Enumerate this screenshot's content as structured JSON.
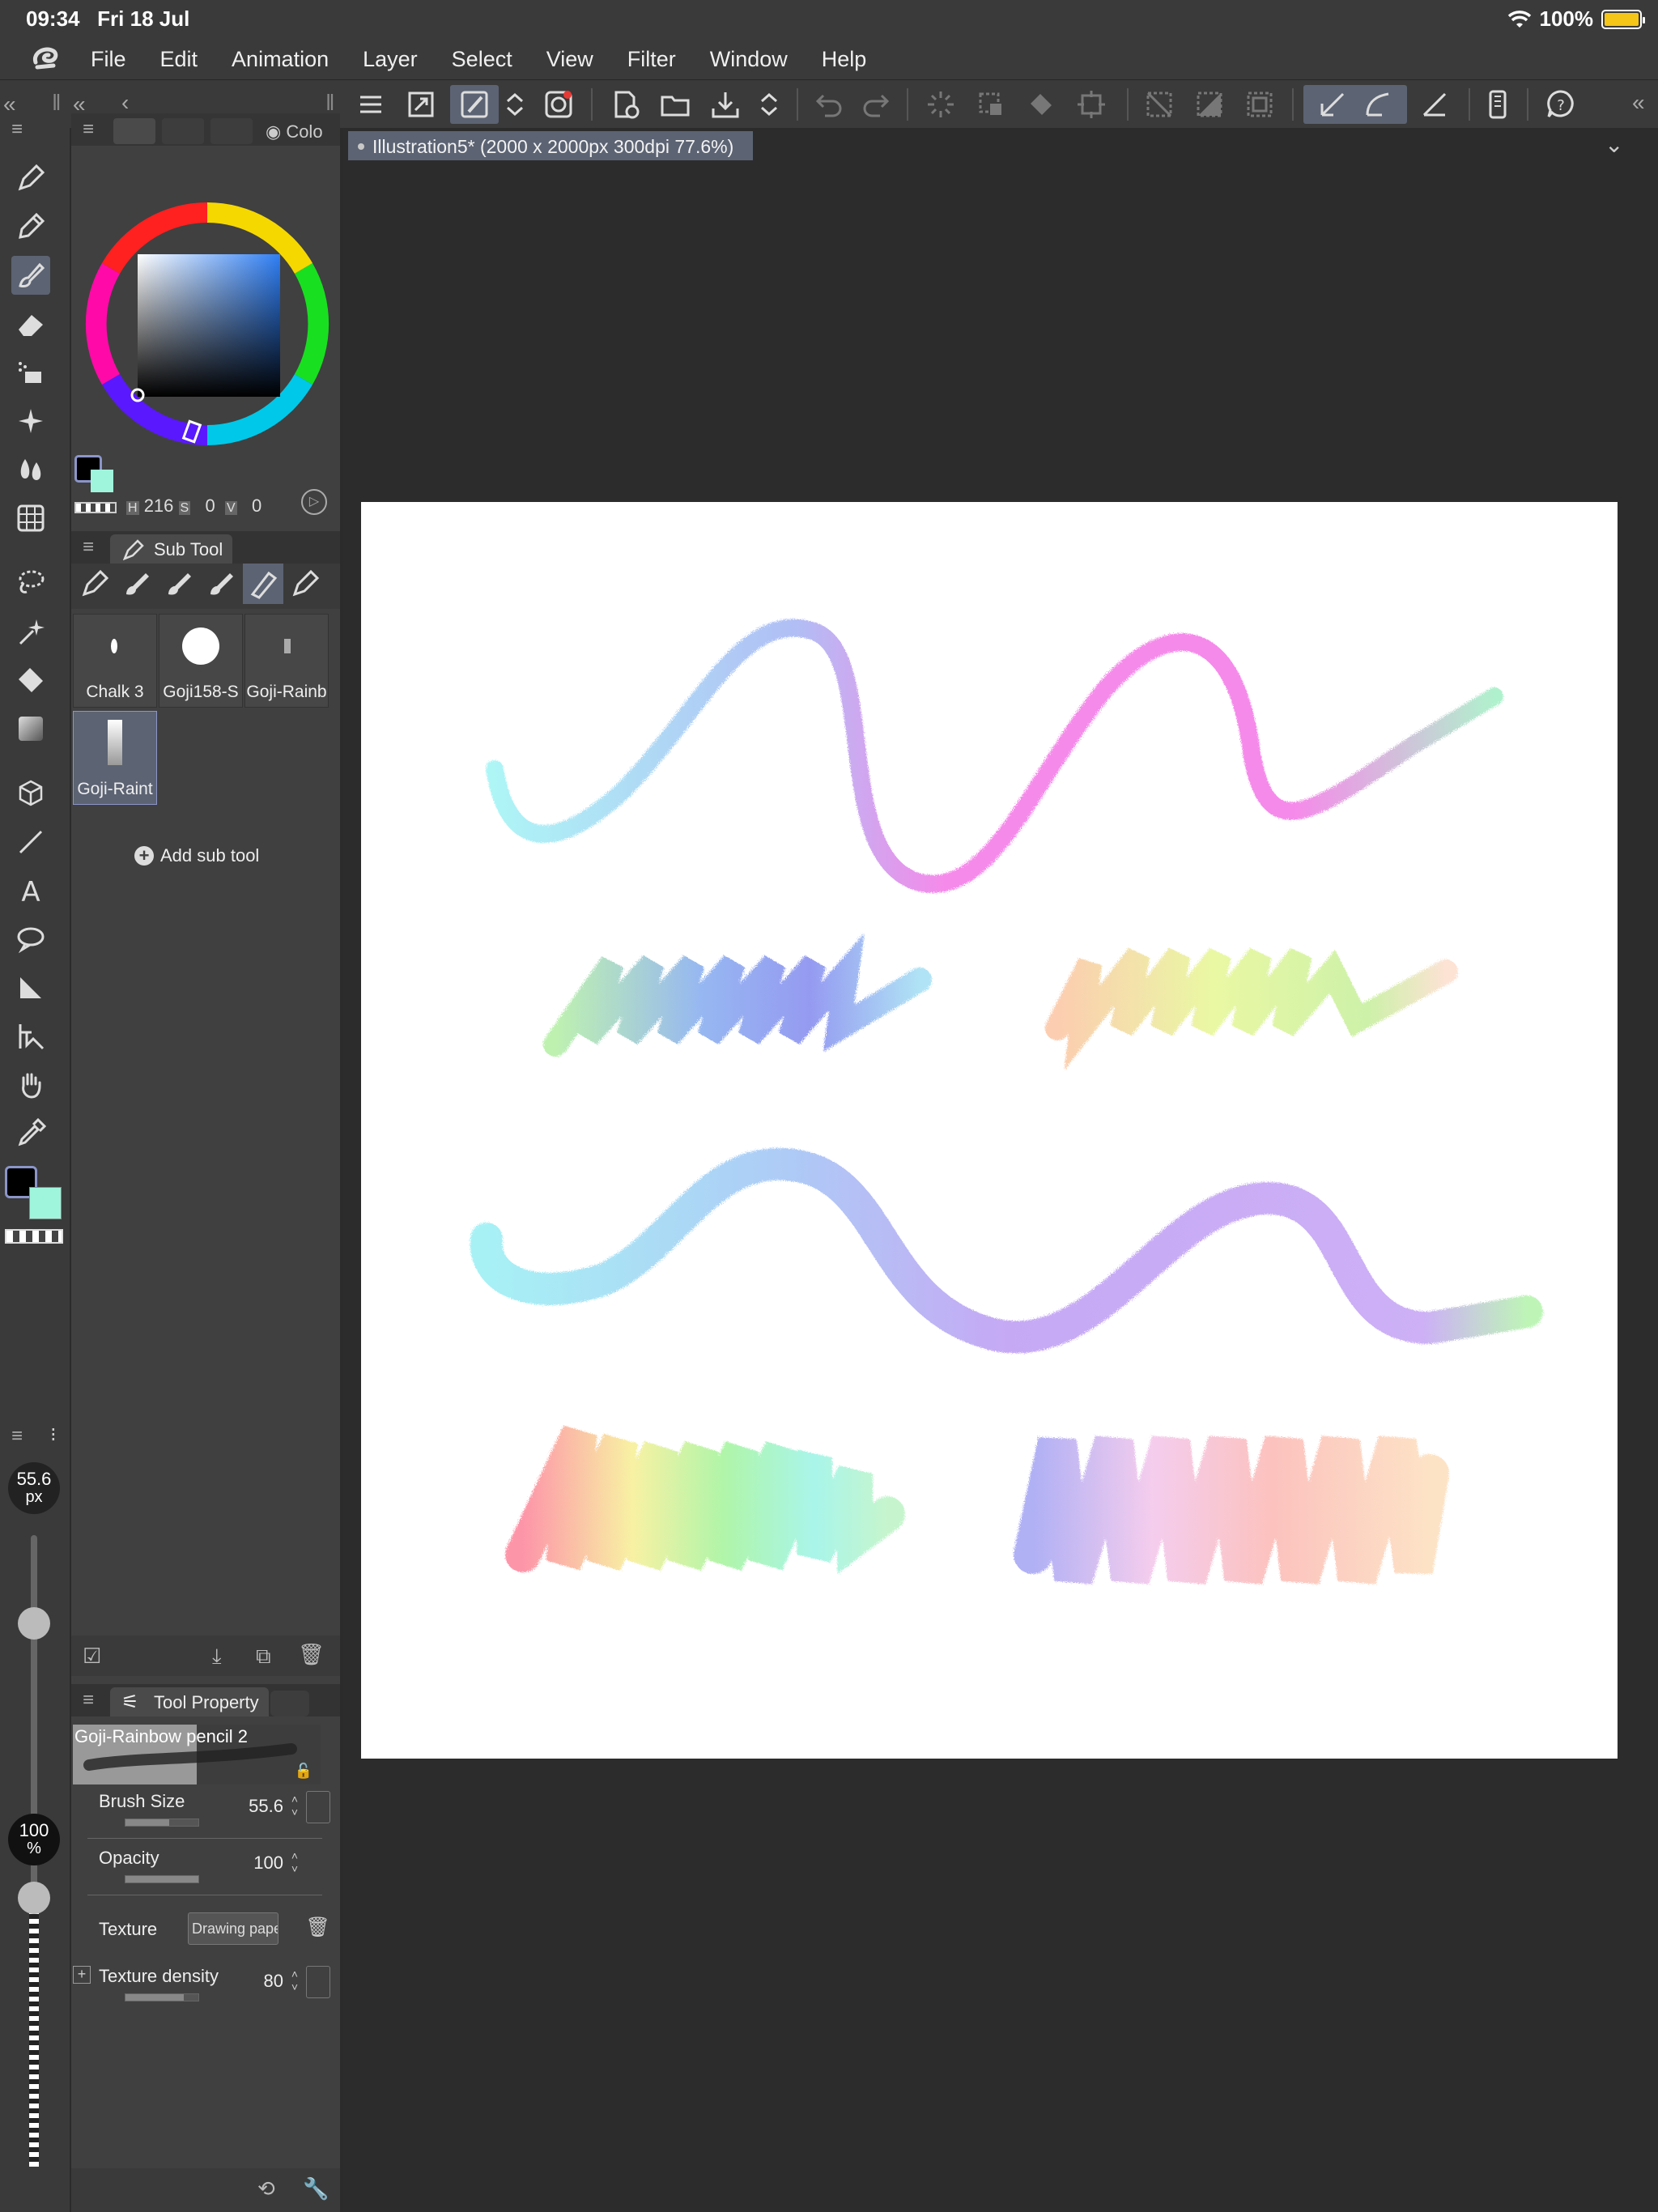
{
  "status_bar": {
    "time": "09:34",
    "date": "Fri 18 Jul",
    "battery": "100%"
  },
  "menu": [
    "File",
    "Edit",
    "Animation",
    "Layer",
    "Select",
    "View",
    "Filter",
    "Window",
    "Help"
  ],
  "document_tab": "Illustration5* (2000 x 2000px 300dpi 77.6%)",
  "color_panel": {
    "tab_label": "Colo",
    "h_label": "H",
    "h_value": "216",
    "s_label": "S",
    "s_value": "0",
    "v_label": "V",
    "v_value": "0"
  },
  "sub_tool_panel": {
    "tab_label": "Sub Tool",
    "brushes": [
      "Chalk 3",
      "Goji158-S",
      "Goji-Rainb",
      "Goji-Raint"
    ],
    "add_label": "Add sub tool"
  },
  "brush_size_indicator": {
    "value": "55.6",
    "unit": "px"
  },
  "opacity_indicator": {
    "value": "100",
    "unit": "%"
  },
  "tool_property": {
    "tab_label": "Tool Property",
    "brush_name": "Goji-Rainbow pencil 2",
    "brush_size_label": "Brush Size",
    "brush_size_value": "55.6",
    "opacity_label": "Opacity",
    "opacity_value": "100",
    "texture_label": "Texture",
    "texture_value": "Drawing pape",
    "texture_density_label": "Texture density",
    "texture_density_value": "80"
  },
  "colors": {
    "main": "#000000",
    "sub": "#9ff5dc",
    "accent": "#5c6373"
  }
}
